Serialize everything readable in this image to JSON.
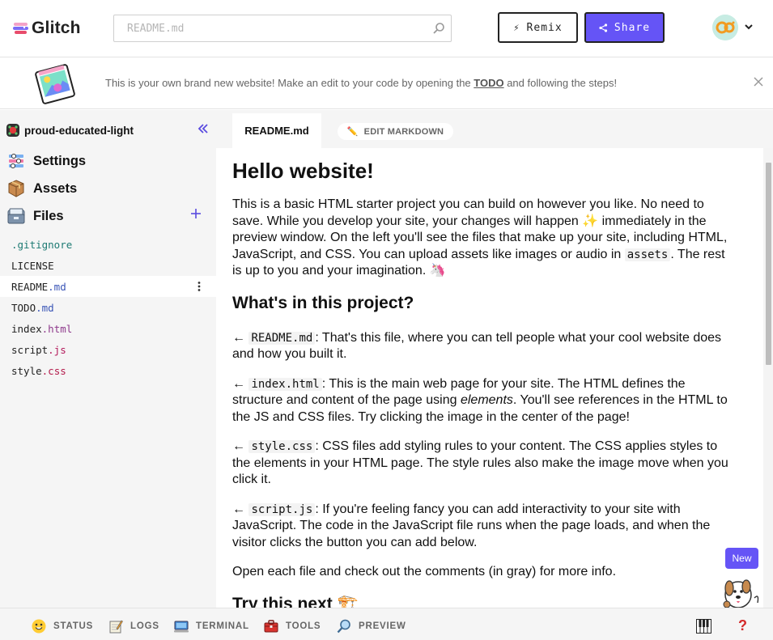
{
  "app": {
    "name": "Glitch"
  },
  "search": {
    "placeholder": "README.md"
  },
  "header": {
    "remix_label": "Remix",
    "share_label": "Share"
  },
  "banner": {
    "text_before": "This is your own brand new website! Make an edit to your code by opening the ",
    "link": "TODO",
    "text_after": " and following the steps!"
  },
  "sidebar": {
    "project_name": "proud-educated-light",
    "nav": [
      {
        "label": "Settings",
        "icon": "settings-icon"
      },
      {
        "label": "Assets",
        "icon": "box-icon"
      },
      {
        "label": "Files",
        "icon": "folder-icon"
      }
    ],
    "files": [
      {
        "base": "",
        "ext": ".gitignore"
      },
      {
        "base": "LICENSE",
        "ext": ""
      },
      {
        "base": "README",
        "ext": ".md"
      },
      {
        "base": "TODO",
        "ext": ".md"
      },
      {
        "base": "index",
        "ext": ".html"
      },
      {
        "base": "script",
        "ext": ".js"
      },
      {
        "base": "style",
        "ext": ".css"
      }
    ],
    "active_file": "README.md"
  },
  "editor": {
    "tab_label": "README.md",
    "edit_label": "EDIT MARKDOWN",
    "doc": {
      "h1": "Hello website!",
      "p1_a": "This is a basic HTML starter project you can build on however you like. No need to save. While you develop your site, your changes will happen ✨ immediately in the preview window. On the left you'll see the files that make up your site, including HTML, JavaScript, and CSS. You can upload assets like images or audio in ",
      "p1_code": "assets",
      "p1_b": ". The rest is up to you and your imagination. 🦄",
      "h2a": "What's in this project?",
      "arrow": "← ",
      "items": [
        {
          "code": "README.md",
          "text": ": That's this file, where you can tell people what your cool website does and how you built it."
        },
        {
          "code": "index.html",
          "text_a": ": This is the main web page for your site. The HTML defines the structure and content of the page using ",
          "em": "elements",
          "text_b": ". You'll see references in the HTML to the JS and CSS files. Try clicking the image in the center of the page!"
        },
        {
          "code": "style.css",
          "text": ": CSS files add styling rules to your content. The CSS applies styles to the elements in your HTML page. The style rules also make the image move when you click it."
        },
        {
          "code": "script.js",
          "text": ": If you're feeling fancy you can add interactivity to your site with JavaScript. The code in the JavaScript file runs when the page loads, and when the visitor clicks the button you can add below."
        }
      ],
      "p_last": "Open each file and check out the comments (in gray) for more info.",
      "h2b": "Try this next 🏗️"
    }
  },
  "mascot": {
    "badge": "New"
  },
  "footer": {
    "items": [
      {
        "label": "STATUS",
        "icon": "smiley-icon"
      },
      {
        "label": "LOGS",
        "icon": "notepad-icon"
      },
      {
        "label": "TERMINAL",
        "icon": "computer-icon"
      },
      {
        "label": "TOOLS",
        "icon": "toolbox-icon"
      },
      {
        "label": "PREVIEW",
        "icon": "magnifier-icon"
      }
    ],
    "help": "?"
  },
  "colors": {
    "accent": "#6554f6",
    "help": "#d42a2a"
  }
}
